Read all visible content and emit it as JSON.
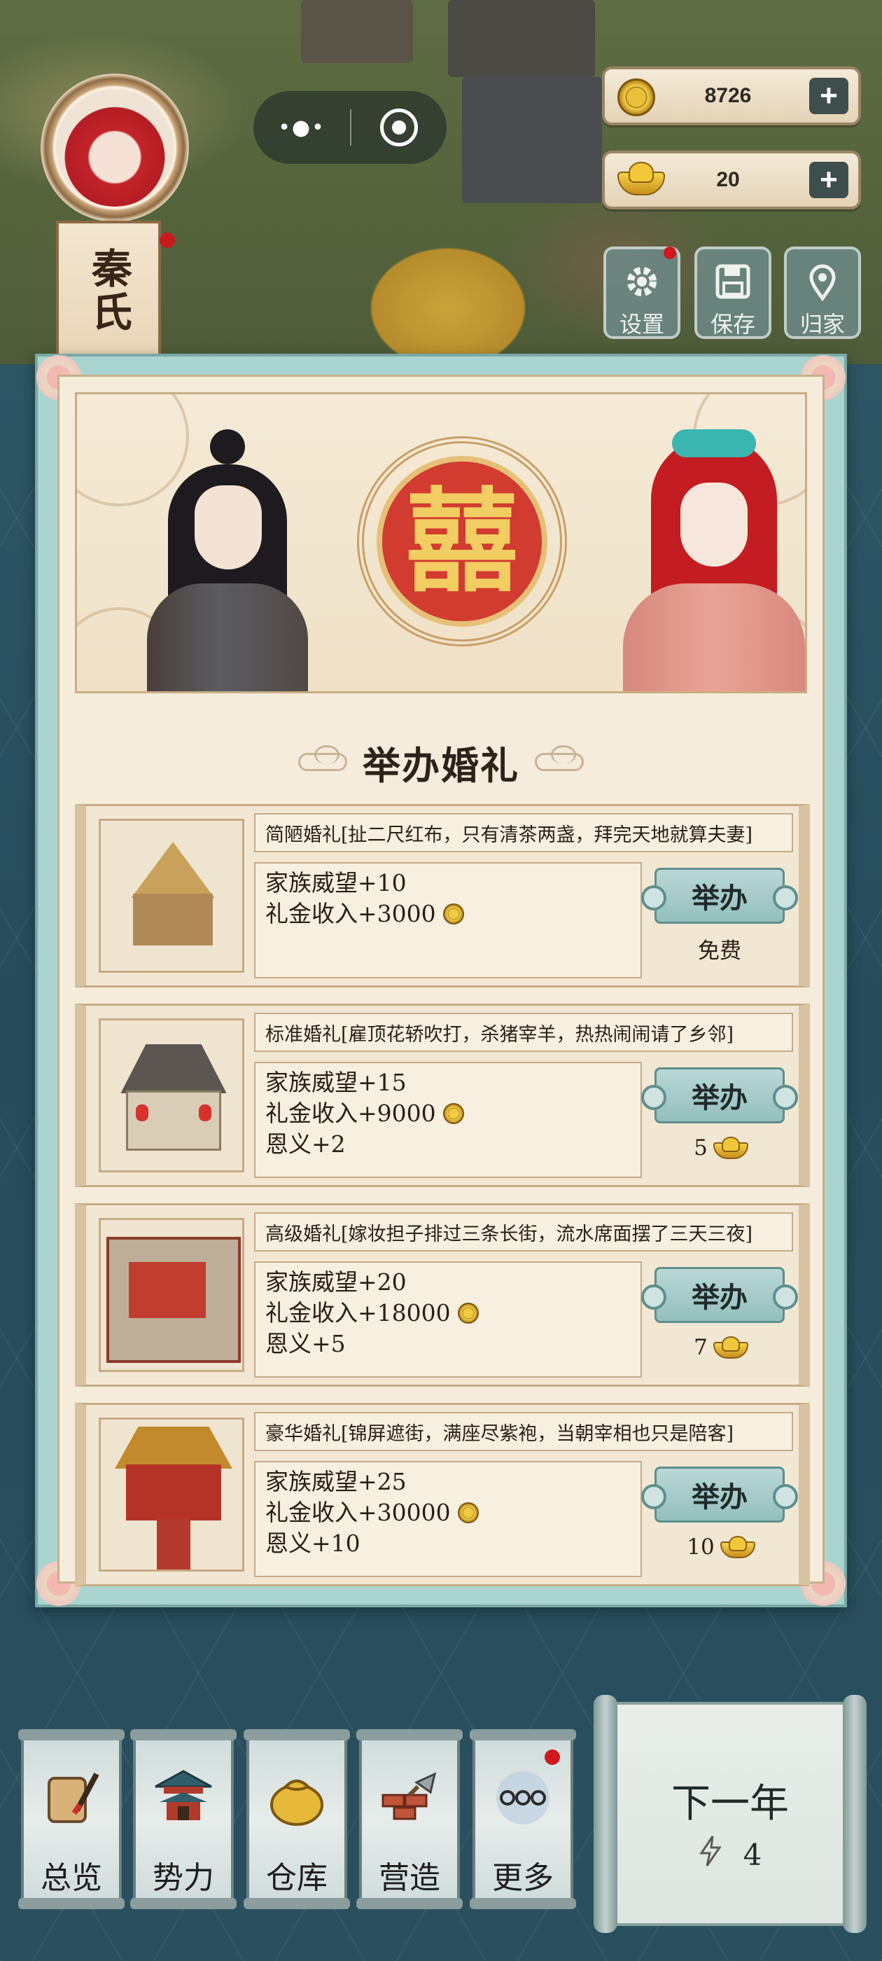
{
  "avatar": {
    "name": "秦氏"
  },
  "capsule": {
    "more": "•●•"
  },
  "currency": {
    "coins": "8726",
    "gold": "20",
    "plus": "+"
  },
  "actions": {
    "settings": "设置",
    "save": "保存",
    "home": "归家"
  },
  "panel": {
    "emblem": "囍",
    "title": "举办婚礼",
    "options": [
      {
        "desc": "简陋婚礼[扯二尺红布，只有清茶两盏，拜完天地就算夫妻]",
        "stat1": "家族威望+10",
        "stat2": "礼金收入+3000",
        "stat3": "",
        "button": "举办",
        "cost": "免费"
      },
      {
        "desc": "标准婚礼[雇顶花轿吹打，杀猪宰羊，热热闹闹请了乡邻]",
        "stat1": "家族威望+15",
        "stat2": "礼金收入+9000",
        "stat3": "恩义+2",
        "button": "举办",
        "cost": "5"
      },
      {
        "desc": "高级婚礼[嫁妆担子排过三条长街，流水席面摆了三天三夜]",
        "stat1": "家族威望+20",
        "stat2": "礼金收入+18000",
        "stat3": "恩义+5",
        "button": "举办",
        "cost": "7"
      },
      {
        "desc": "豪华婚礼[锦屏遮街，满座尽紫袍，当朝宰相也只是陪客]",
        "stat1": "家族威望+25",
        "stat2": "礼金收入+30000",
        "stat3": "恩义+10",
        "button": "举办",
        "cost": "10"
      }
    ]
  },
  "nav": {
    "overview": "总览",
    "power": "势力",
    "warehouse": "仓库",
    "build": "营造",
    "more": "更多"
  },
  "next_year": {
    "label": "下一年",
    "energy": "4"
  },
  "colors": {
    "accent_red": "#c8191d",
    "panel_teal": "#a9d4d0",
    "parchment": "#f6ecdb"
  }
}
